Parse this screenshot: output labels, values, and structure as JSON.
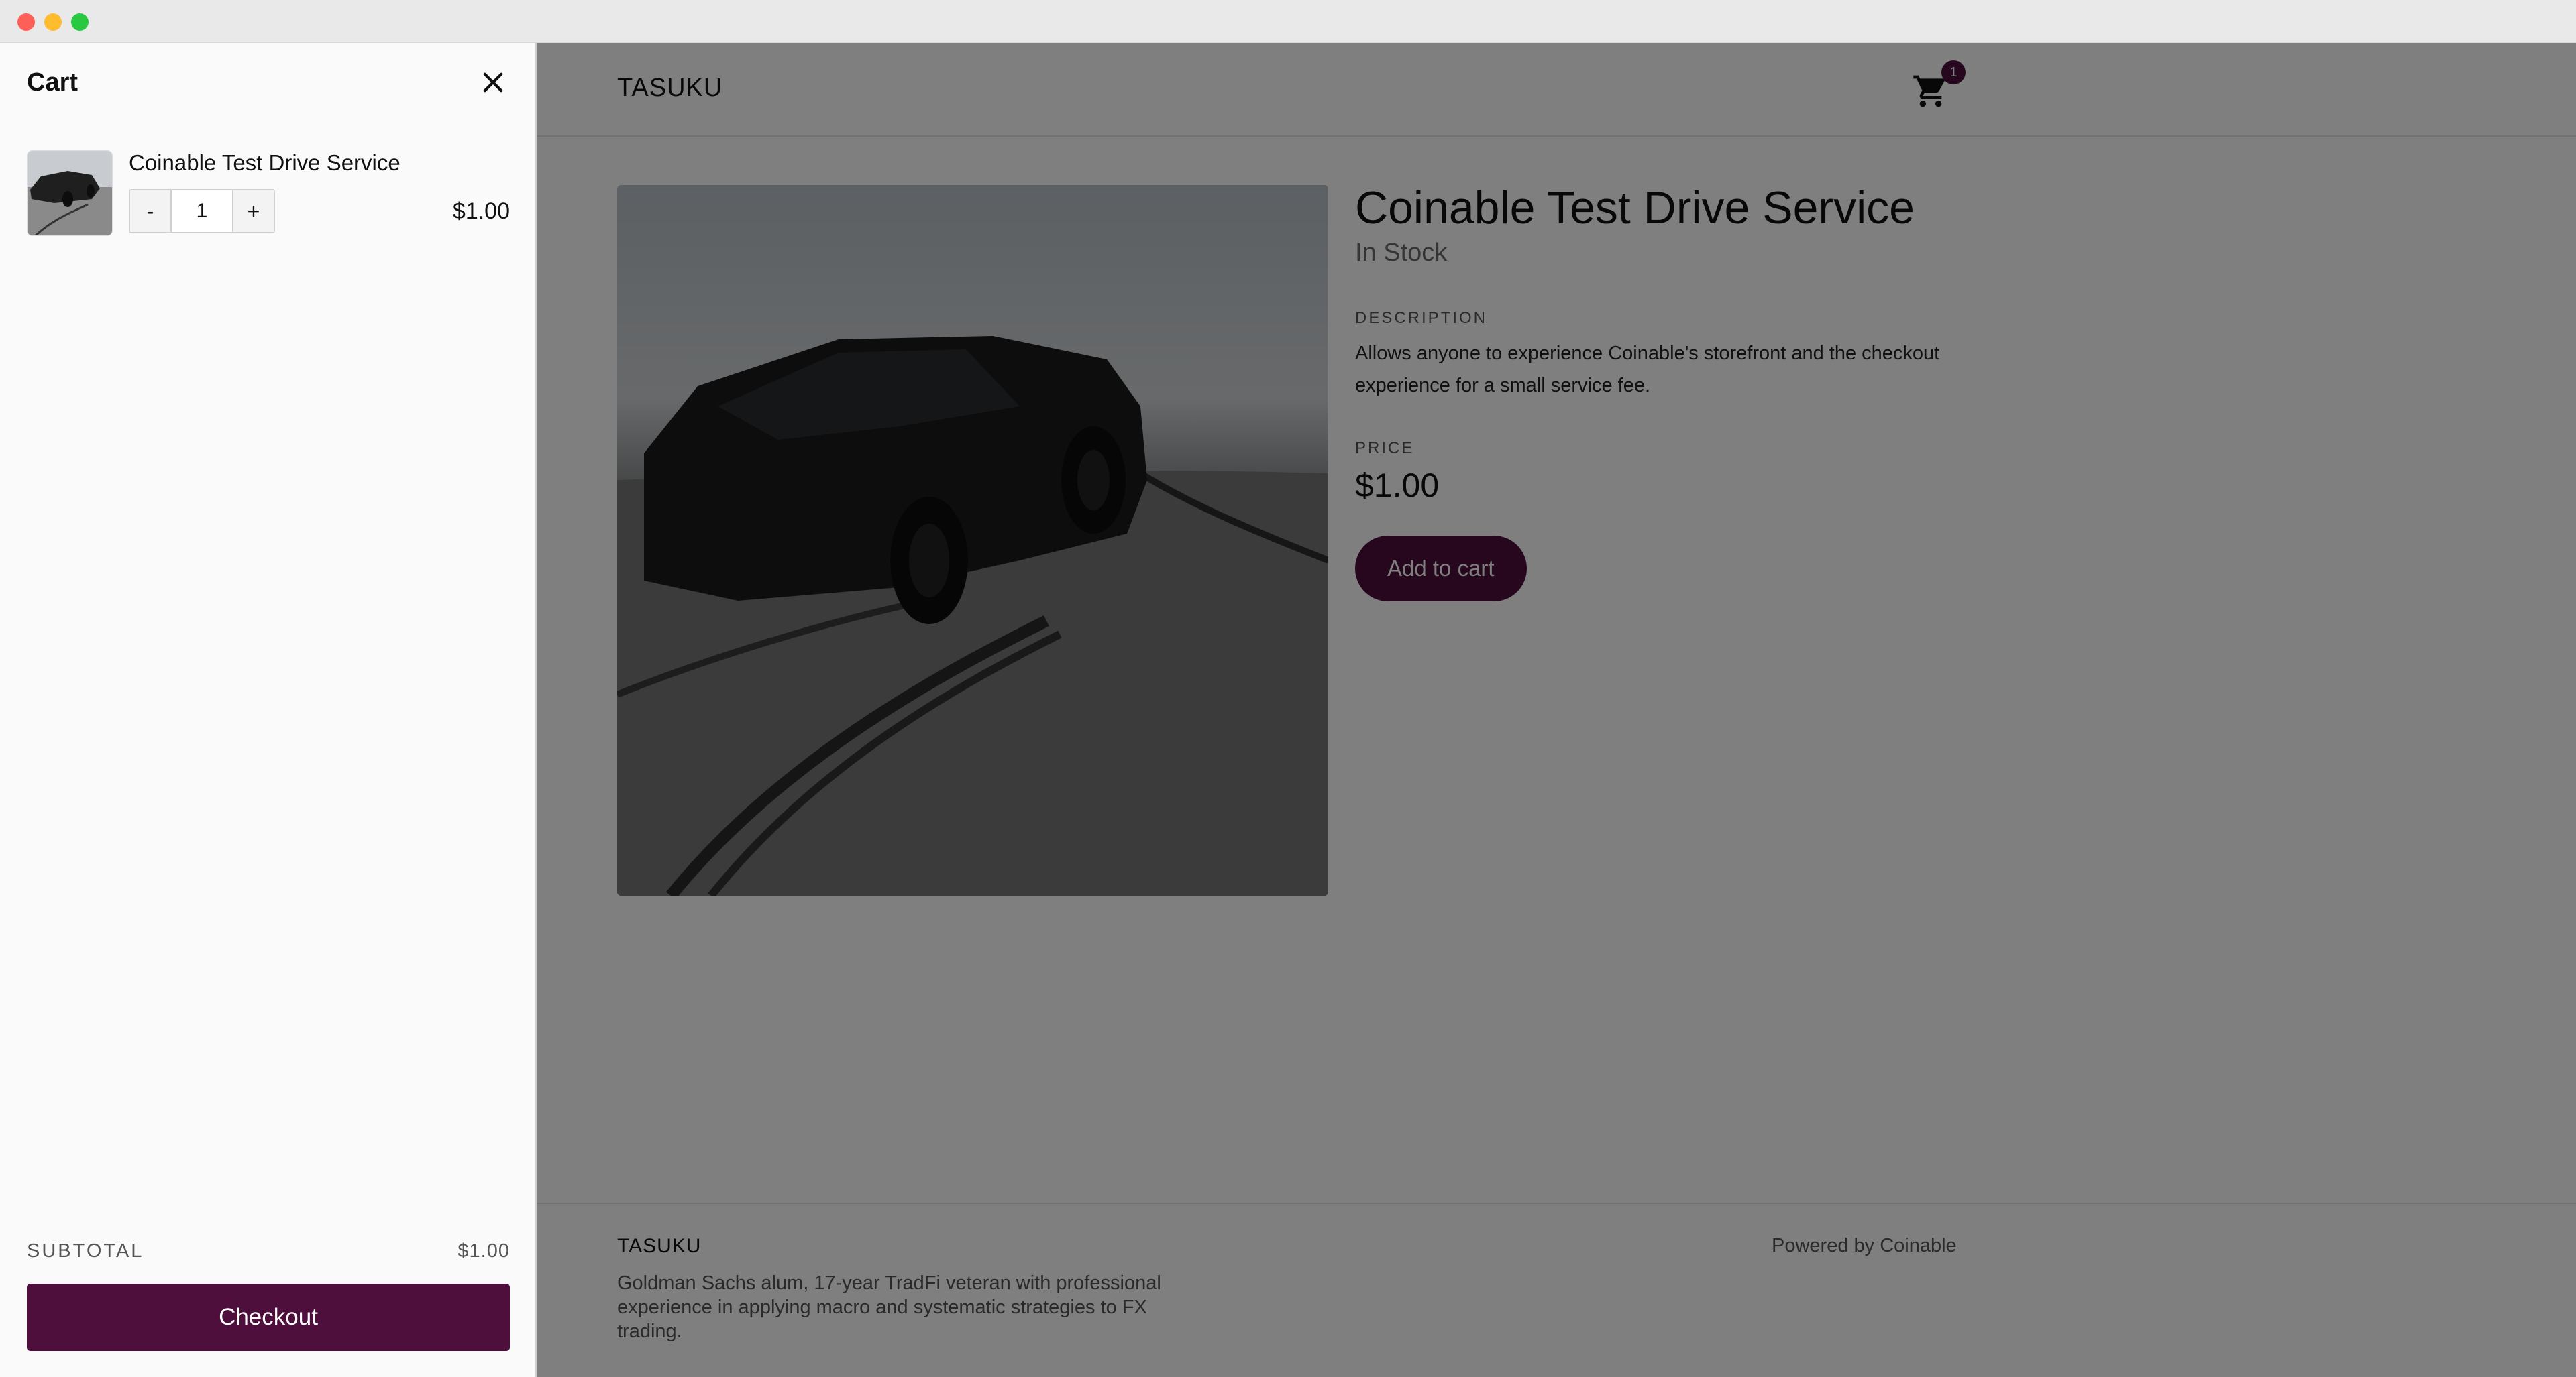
{
  "colors": {
    "accent": "#4e0f3d",
    "overlay": "rgba(0,0,0,0.5)",
    "drawer_bg": "#fafafa"
  },
  "header": {
    "brand": "TASUKU",
    "cart_icon": "shopping-cart-icon",
    "cart_count": "1"
  },
  "product": {
    "title": "Coinable Test Drive Service",
    "stock": "In Stock",
    "description_label": "DESCRIPTION",
    "description": "Allows anyone to experience Coinable's storefront and the checkout experience for a small service fee.",
    "price_label": "PRICE",
    "price": "$1.00",
    "add_to_cart_label": "Add to cart"
  },
  "footer": {
    "brand": "TASUKU",
    "about": "Goldman Sachs alum, 17-year TradFi veteran with professional experience in applying macro and systematic strategies to FX trading.",
    "powered_by": "Powered by Coinable"
  },
  "cart": {
    "title": "Cart",
    "close_icon": "close-icon",
    "items": [
      {
        "name": "Coinable Test Drive Service",
        "quantity": "1",
        "minus_label": "-",
        "plus_label": "+",
        "price": "$1.00"
      }
    ],
    "subtotal_label": "SUBTOTAL",
    "subtotal_value": "$1.00",
    "checkout_label": "Checkout"
  }
}
